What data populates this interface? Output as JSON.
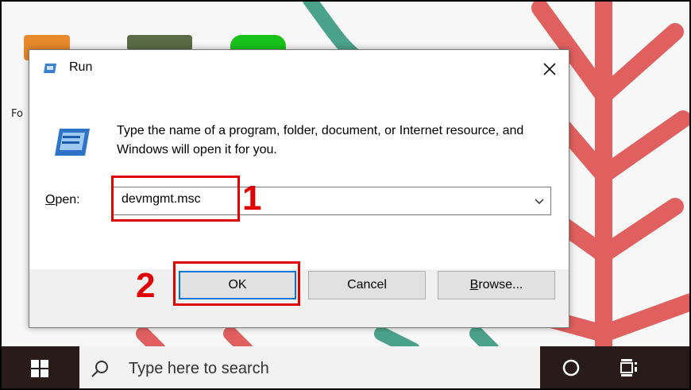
{
  "desktop": {
    "icon_label_partial": "Fo"
  },
  "run_dialog": {
    "title": "Run",
    "description": "Type the name of a program, folder, document, or Internet resource, and Windows will open it for you.",
    "open_label_accel": "O",
    "open_label_rest": "pen:",
    "command_value": "devmgmt.msc",
    "buttons": {
      "ok": "OK",
      "cancel": "Cancel",
      "browse_accel": "B",
      "browse_rest": "rowse..."
    }
  },
  "annotations": {
    "step1": "1",
    "step2": "2",
    "color": "#e00000"
  },
  "taskbar": {
    "search_placeholder": "Type here to search"
  },
  "colors": {
    "accent": "#0078d7",
    "taskbar": "#2a1b1b",
    "branch_red": "#e06060",
    "branch_teal": "#4aa28a"
  }
}
